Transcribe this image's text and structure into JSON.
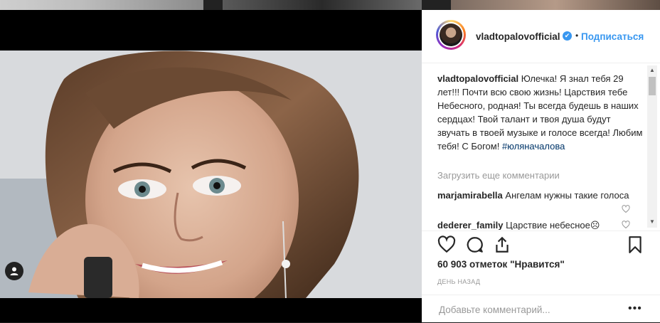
{
  "post": {
    "username": "vladtopalovofficial",
    "verified_badge": "✔",
    "separator": "•",
    "follow_label": "Подписаться",
    "caption_user": "vladtopalovofficial",
    "caption_text": "Юлечка! Я знал тебя 29 лет!!! Почти всю свою жизнь! Царствия тебе Небесного, родная! Ты всегда будешь в наших сердцах! Твой талант и твоя душа будут звучать в твоей музыке и голосе всегда! Любим тебя! С Богом!",
    "caption_hashtag": "#юляначалова",
    "load_more_label": "Загрузить еще комментарии",
    "likes_label": "60 903 отметок \"Нравится\"",
    "time_label": "ДЕНЬ НАЗАД",
    "comment_placeholder": "Добавьте комментарий...",
    "more_label": "•••"
  },
  "comments": [
    {
      "user": "marjamirabella",
      "text": "Ангелам нужны такие голоса"
    },
    {
      "user": "dederer_family",
      "text": "Царствие небесное☹"
    }
  ],
  "icons": [
    "user-tag-icon",
    "heart-icon",
    "comment-icon",
    "share-icon",
    "bookmark-icon",
    "verified-icon"
  ],
  "colors": {
    "accent": "#3897f0",
    "text": "#262626",
    "muted": "#999999",
    "hashtag": "#003569"
  }
}
